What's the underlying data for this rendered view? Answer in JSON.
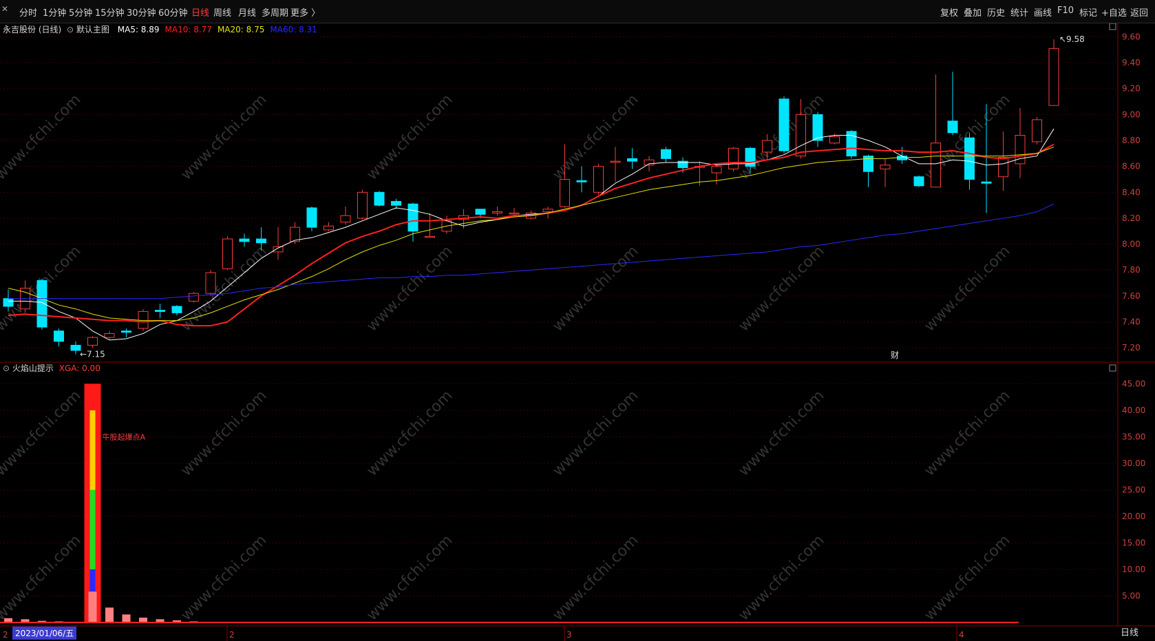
{
  "toolbar": {
    "left_items": [
      "分时",
      "1分钟",
      "5分钟",
      "15分钟",
      "30分钟",
      "60分钟",
      "日线",
      "周线",
      "月线",
      "多周期",
      "更多 〉"
    ],
    "active_index": 6,
    "right_items": [
      "复权",
      "叠加",
      "历史",
      "统计",
      "画线",
      "F10",
      "标记",
      "+自选",
      "返回"
    ]
  },
  "main_panel": {
    "stock": "永吉股份 (日线)",
    "template": "默认主图",
    "ma": [
      {
        "label": "MA5: 8.89",
        "color": "#ffffff"
      },
      {
        "label": "MA10: 8.77",
        "color": "#ff2020"
      },
      {
        "label": "MA20: 8.75",
        "color": "#e6e600"
      },
      {
        "label": "MA60: 8.31",
        "color": "#2a2aff"
      }
    ],
    "high_label": "9.58",
    "low_label": "7.15",
    "event_label": "财",
    "y_ticks": [
      "9.60",
      "9.40",
      "9.20",
      "9.00",
      "8.80",
      "8.60",
      "8.40",
      "8.20",
      "8.00",
      "7.80",
      "7.60",
      "7.40",
      "7.20"
    ]
  },
  "sub_panel": {
    "title": "火焰山提示",
    "indicator": "XGA: 0.00",
    "annotation": "牛股起爆点A",
    "y_ticks": [
      "45.00",
      "40.00",
      "35.00",
      "30.00",
      "25.00",
      "20.00",
      "15.00",
      "10.00",
      "5.00"
    ]
  },
  "x_axis": {
    "date_label": "2023/01/06/五",
    "month_labels": [
      "2",
      "3",
      "4"
    ],
    "left_mark": "2"
  },
  "bottom_tab": "日线",
  "watermark": "www.cfchi.com",
  "colors": {
    "up": "#ff3b3b",
    "down": "#00e5ff",
    "bg": "#000000",
    "grid": "#3a0000"
  },
  "chart_data": {
    "type": "candlestick",
    "ylim": [
      7.1,
      9.65
    ],
    "candles": [
      {
        "o": 7.58,
        "c": 7.52,
        "h": 7.65,
        "l": 7.48
      },
      {
        "o": 7.5,
        "c": 7.66,
        "h": 7.72,
        "l": 7.47
      },
      {
        "o": 7.72,
        "c": 7.36,
        "h": 7.73,
        "l": 7.34
      },
      {
        "o": 7.33,
        "c": 7.25,
        "h": 7.35,
        "l": 7.21
      },
      {
        "o": 7.22,
        "c": 7.18,
        "h": 7.25,
        "l": 7.15
      },
      {
        "o": 7.22,
        "c": 7.28,
        "h": 7.29,
        "l": 7.2
      },
      {
        "o": 7.28,
        "c": 7.31,
        "h": 7.33,
        "l": 7.26
      },
      {
        "o": 7.33,
        "c": 7.32,
        "h": 7.35,
        "l": 7.28
      },
      {
        "o": 7.35,
        "c": 7.48,
        "h": 7.5,
        "l": 7.33
      },
      {
        "o": 7.49,
        "c": 7.48,
        "h": 7.54,
        "l": 7.43
      },
      {
        "o": 7.52,
        "c": 7.47,
        "h": 7.53,
        "l": 7.45
      },
      {
        "o": 7.56,
        "c": 7.62,
        "h": 7.63,
        "l": 7.55
      },
      {
        "o": 7.62,
        "c": 7.78,
        "h": 7.8,
        "l": 7.6
      },
      {
        "o": 7.81,
        "c": 8.04,
        "h": 8.06,
        "l": 7.8
      },
      {
        "o": 8.04,
        "c": 8.02,
        "h": 8.08,
        "l": 7.98
      },
      {
        "o": 8.04,
        "c": 8.01,
        "h": 8.13,
        "l": 7.95
      },
      {
        "o": 7.94,
        "c": 7.98,
        "h": 8.13,
        "l": 7.88
      },
      {
        "o": 8.02,
        "c": 8.13,
        "h": 8.17,
        "l": 8.0
      },
      {
        "o": 8.28,
        "c": 8.13,
        "h": 8.29,
        "l": 8.1
      },
      {
        "o": 8.11,
        "c": 8.14,
        "h": 8.17,
        "l": 8.1
      },
      {
        "o": 8.17,
        "c": 8.22,
        "h": 8.29,
        "l": 8.15
      },
      {
        "o": 8.2,
        "c": 8.4,
        "h": 8.42,
        "l": 8.19
      },
      {
        "o": 8.4,
        "c": 8.3,
        "h": 8.41,
        "l": 8.29
      },
      {
        "o": 8.33,
        "c": 8.3,
        "h": 8.35,
        "l": 8.27
      },
      {
        "o": 8.31,
        "c": 8.1,
        "h": 8.32,
        "l": 8.02
      },
      {
        "o": 8.06,
        "c": 8.06,
        "h": 8.24,
        "l": 8.05
      },
      {
        "o": 8.1,
        "c": 8.18,
        "h": 8.22,
        "l": 8.08
      },
      {
        "o": 8.19,
        "c": 8.22,
        "h": 8.27,
        "l": 8.12
      },
      {
        "o": 8.27,
        "c": 8.23,
        "h": 8.27,
        "l": 8.2
      },
      {
        "o": 8.24,
        "c": 8.25,
        "h": 8.29,
        "l": 8.22
      },
      {
        "o": 8.24,
        "c": 8.24,
        "h": 8.28,
        "l": 8.21
      },
      {
        "o": 8.2,
        "c": 8.24,
        "h": 8.26,
        "l": 8.19
      },
      {
        "o": 8.25,
        "c": 8.27,
        "h": 8.29,
        "l": 8.2
      },
      {
        "o": 8.29,
        "c": 8.5,
        "h": 8.77,
        "l": 8.28
      },
      {
        "o": 8.49,
        "c": 8.48,
        "h": 8.6,
        "l": 8.4
      },
      {
        "o": 8.4,
        "c": 8.6,
        "h": 8.62,
        "l": 8.38
      },
      {
        "o": 8.64,
        "c": 8.64,
        "h": 8.75,
        "l": 8.48
      },
      {
        "o": 8.66,
        "c": 8.64,
        "h": 8.74,
        "l": 8.58
      },
      {
        "o": 8.61,
        "c": 8.65,
        "h": 8.68,
        "l": 8.56
      },
      {
        "o": 8.73,
        "c": 8.66,
        "h": 8.75,
        "l": 8.63
      },
      {
        "o": 8.64,
        "c": 8.59,
        "h": 8.67,
        "l": 8.55
      },
      {
        "o": 8.6,
        "c": 8.6,
        "h": 8.64,
        "l": 8.45
      },
      {
        "o": 8.55,
        "c": 8.6,
        "h": 8.62,
        "l": 8.46
      },
      {
        "o": 8.58,
        "c": 8.74,
        "h": 8.75,
        "l": 8.56
      },
      {
        "o": 8.74,
        "c": 8.6,
        "h": 8.75,
        "l": 8.55
      },
      {
        "o": 8.71,
        "c": 8.8,
        "h": 8.85,
        "l": 8.65
      },
      {
        "o": 9.12,
        "c": 8.72,
        "h": 9.14,
        "l": 8.7
      },
      {
        "o": 8.68,
        "c": 9.0,
        "h": 9.12,
        "l": 8.66
      },
      {
        "o": 9.0,
        "c": 8.8,
        "h": 9.02,
        "l": 8.75
      },
      {
        "o": 8.78,
        "c": 8.83,
        "h": 8.85,
        "l": 8.77
      },
      {
        "o": 8.87,
        "c": 8.68,
        "h": 8.88,
        "l": 8.66
      },
      {
        "o": 8.68,
        "c": 8.56,
        "h": 8.69,
        "l": 8.44
      },
      {
        "o": 8.58,
        "c": 8.61,
        "h": 8.66,
        "l": 8.44
      },
      {
        "o": 8.68,
        "c": 8.65,
        "h": 8.75,
        "l": 8.62
      },
      {
        "o": 8.52,
        "c": 8.45,
        "h": 8.53,
        "l": 8.44
      },
      {
        "o": 8.44,
        "c": 8.78,
        "h": 9.31,
        "l": 8.44
      },
      {
        "o": 8.95,
        "c": 8.86,
        "h": 9.33,
        "l": 8.84
      },
      {
        "o": 8.82,
        "c": 8.5,
        "h": 8.86,
        "l": 8.42
      },
      {
        "o": 8.48,
        "c": 8.47,
        "h": 9.08,
        "l": 8.24
      },
      {
        "o": 8.52,
        "c": 8.67,
        "h": 8.87,
        "l": 8.41
      },
      {
        "o": 8.62,
        "c": 8.84,
        "h": 9.05,
        "l": 8.51
      },
      {
        "o": 8.79,
        "c": 8.96,
        "h": 8.98,
        "l": 8.77
      },
      {
        "o": 9.07,
        "c": 9.51,
        "h": 9.58,
        "l": 9.07
      }
    ],
    "ma": [
      {
        "name": "MA5",
        "color": "#ffffff",
        "values": [
          7.56,
          7.56,
          7.55,
          7.48,
          7.43,
          7.33,
          7.26,
          7.27,
          7.31,
          7.38,
          7.41,
          7.48,
          7.56,
          7.67,
          7.78,
          7.89,
          7.97,
          8.03,
          8.05,
          8.09,
          8.13,
          8.18,
          8.23,
          8.28,
          8.26,
          8.23,
          8.18,
          8.14,
          8.17,
          8.19,
          8.22,
          8.23,
          8.24,
          8.26,
          8.3,
          8.37,
          8.47,
          8.54,
          8.62,
          8.63,
          8.63,
          8.63,
          8.61,
          8.62,
          8.62,
          8.65,
          8.69,
          8.76,
          8.82,
          8.84,
          8.84,
          8.8,
          8.75,
          8.68,
          8.62,
          8.62,
          8.65,
          8.64,
          8.61,
          8.62,
          8.66,
          8.68,
          8.89
        ]
      },
      {
        "name": "MA10",
        "color": "#ff2020",
        "values": [
          7.45,
          7.46,
          7.45,
          7.44,
          7.43,
          7.42,
          7.41,
          7.41,
          7.4,
          7.41,
          7.38,
          7.37,
          7.37,
          7.4,
          7.5,
          7.6,
          7.68,
          7.76,
          7.85,
          7.93,
          8.01,
          8.06,
          8.1,
          8.15,
          8.18,
          8.18,
          8.19,
          8.2,
          8.21,
          8.2,
          8.22,
          8.22,
          8.24,
          8.26,
          8.3,
          8.37,
          8.43,
          8.47,
          8.51,
          8.54,
          8.57,
          8.6,
          8.62,
          8.63,
          8.63,
          8.65,
          8.67,
          8.71,
          8.72,
          8.73,
          8.74,
          8.73,
          8.72,
          8.72,
          8.71,
          8.71,
          8.72,
          8.7,
          8.67,
          8.66,
          8.68,
          8.7,
          8.77
        ]
      },
      {
        "name": "MA20",
        "color": "#e6e600",
        "values": [
          7.66,
          7.63,
          7.58,
          7.53,
          7.5,
          7.46,
          7.43,
          7.42,
          7.41,
          7.41,
          7.41,
          7.43,
          7.47,
          7.52,
          7.57,
          7.61,
          7.65,
          7.7,
          7.75,
          7.81,
          7.88,
          7.94,
          7.99,
          8.03,
          8.08,
          8.11,
          8.14,
          8.16,
          8.18,
          8.19,
          8.21,
          8.22,
          8.24,
          8.27,
          8.3,
          8.33,
          8.36,
          8.39,
          8.42,
          8.44,
          8.46,
          8.48,
          8.49,
          8.51,
          8.53,
          8.56,
          8.59,
          8.61,
          8.63,
          8.64,
          8.65,
          8.66,
          8.66,
          8.67,
          8.67,
          8.68,
          8.68,
          8.68,
          8.68,
          8.68,
          8.69,
          8.7,
          8.75
        ]
      },
      {
        "name": "MA60",
        "color": "#2a2aff",
        "values": [
          7.58,
          7.58,
          7.58,
          7.58,
          7.58,
          7.58,
          7.58,
          7.58,
          7.58,
          7.58,
          7.59,
          7.6,
          7.61,
          7.62,
          7.64,
          7.66,
          7.67,
          7.69,
          7.7,
          7.71,
          7.72,
          7.73,
          7.74,
          7.74,
          7.75,
          7.75,
          7.76,
          7.76,
          7.77,
          7.78,
          7.79,
          7.8,
          7.81,
          7.82,
          7.83,
          7.84,
          7.85,
          7.86,
          7.87,
          7.88,
          7.89,
          7.9,
          7.91,
          7.92,
          7.93,
          7.94,
          7.96,
          7.98,
          7.99,
          8.01,
          8.03,
          8.05,
          8.07,
          8.08,
          8.1,
          8.12,
          8.14,
          8.16,
          8.18,
          8.2,
          8.22,
          8.25,
          8.31
        ]
      }
    ],
    "sub_ylim": [
      0,
      47
    ],
    "sub_bars": [
      {
        "i": 0,
        "v": 0.8
      },
      {
        "i": 1,
        "v": 0.6
      },
      {
        "i": 2,
        "v": 0.3
      },
      {
        "i": 3,
        "v": 0.2
      },
      {
        "i": 5,
        "v": 5.8
      },
      {
        "i": 6,
        "v": 2.8
      },
      {
        "i": 7,
        "v": 1.5
      },
      {
        "i": 8,
        "v": 0.9
      },
      {
        "i": 9,
        "v": 0.6
      },
      {
        "i": 10,
        "v": 0.4
      },
      {
        "i": 11,
        "v": 0.2
      }
    ],
    "flame": {
      "i": 5,
      "red_top": 45,
      "yellow": [
        5.8,
        40
      ],
      "green": [
        10,
        25
      ],
      "blue": [
        5.8,
        10
      ]
    }
  }
}
